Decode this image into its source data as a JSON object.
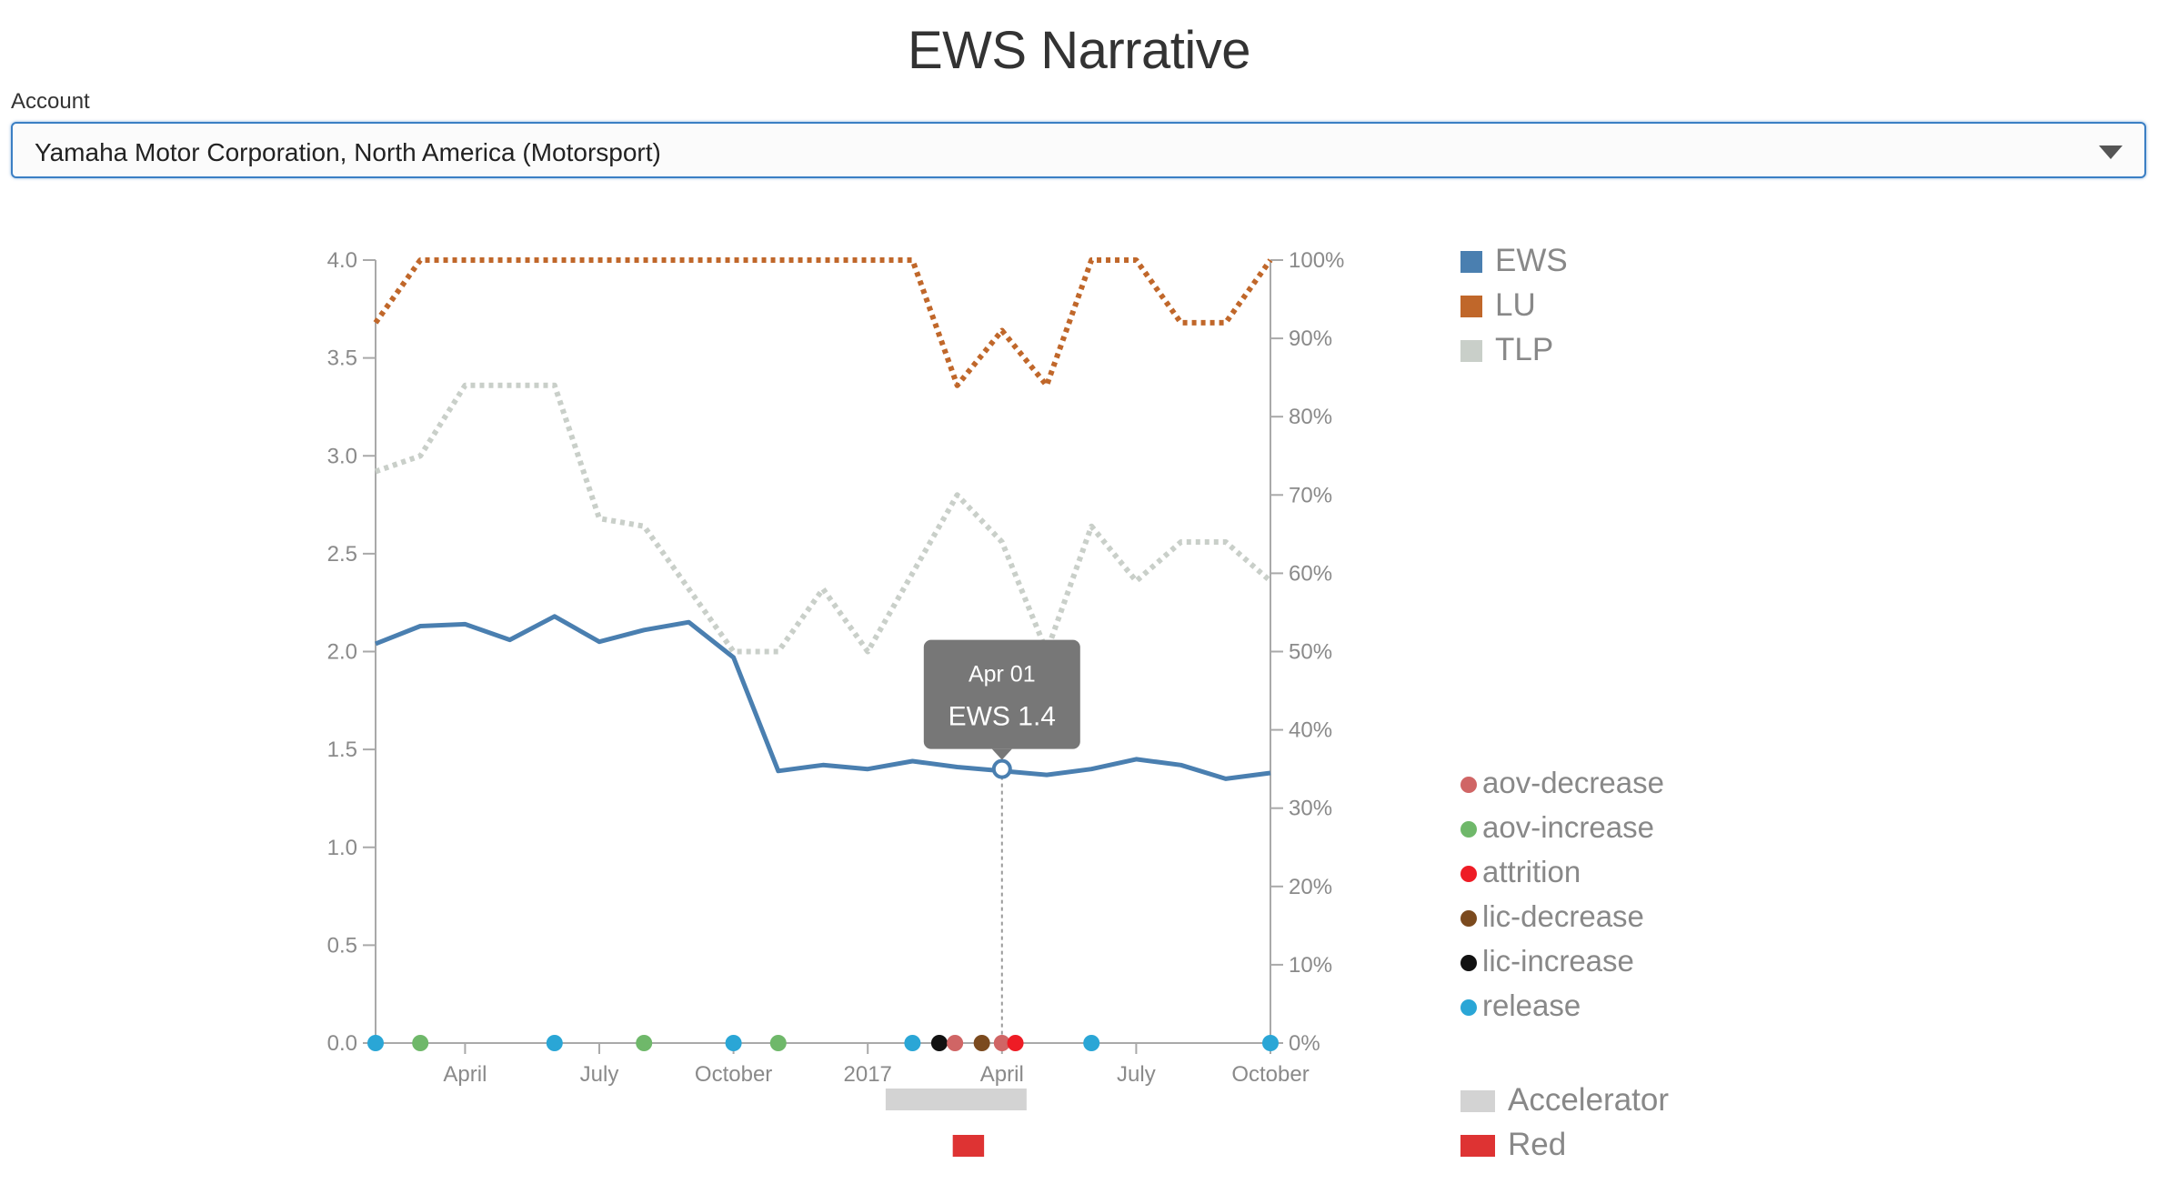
{
  "page": {
    "title": "EWS Narrative",
    "account_label": "Account",
    "account_value": "Yamaha Motor Corporation, North America (Motorsport)"
  },
  "chart_data": {
    "type": "line",
    "x_tick_labels": [
      "April",
      "July",
      "October",
      "2017",
      "April",
      "July",
      "October"
    ],
    "x_tick_months": [
      3,
      6,
      9,
      12,
      15,
      18,
      21
    ],
    "xlim_months": [
      1,
      21
    ],
    "x_points_months": [
      1,
      2,
      3,
      4,
      5,
      6,
      7,
      8,
      9,
      10,
      11,
      12,
      13,
      14,
      15,
      16,
      17,
      18,
      19,
      20,
      21
    ],
    "y_left": {
      "lim": [
        0,
        4
      ],
      "ticks": [
        "0.0",
        "0.5",
        "1.0",
        "1.5",
        "2.0",
        "2.5",
        "3.0",
        "3.5",
        "4.0"
      ]
    },
    "y_right": {
      "lim": [
        0,
        100
      ],
      "ticks": [
        "0%",
        "10%",
        "20%",
        "30%",
        "40%",
        "50%",
        "60%",
        "70%",
        "80%",
        "90%",
        "100%"
      ]
    },
    "series": [
      {
        "name": "EWS",
        "axis": "left",
        "color": "#4a7fb0",
        "style": "solid",
        "values": [
          2.04,
          2.13,
          2.14,
          2.06,
          2.18,
          2.05,
          2.11,
          2.15,
          1.97,
          1.39,
          1.42,
          1.4,
          1.44,
          1.41,
          1.39,
          1.37,
          1.4,
          1.45,
          1.42,
          1.35,
          1.38
        ]
      },
      {
        "name": "LU",
        "axis": "right",
        "color": "#c0672a",
        "style": "dotted",
        "values": [
          92,
          100,
          100,
          100,
          100,
          100,
          100,
          100,
          100,
          100,
          100,
          100,
          100,
          84,
          91,
          84,
          100,
          100,
          92,
          92,
          100
        ]
      },
      {
        "name": "TLP",
        "axis": "right",
        "color": "#c9cfc9",
        "style": "dotted",
        "values": [
          73,
          75,
          84,
          84,
          84,
          67,
          66,
          58,
          50,
          50,
          58,
          50,
          60,
          70,
          64,
          50,
          66,
          59,
          64,
          64,
          59
        ]
      }
    ],
    "events": [
      {
        "type": "release",
        "month": 1
      },
      {
        "type": "aov-increase",
        "month": 2
      },
      {
        "type": "release",
        "month": 5
      },
      {
        "type": "aov-increase",
        "month": 7
      },
      {
        "type": "release",
        "month": 9
      },
      {
        "type": "aov-increase",
        "month": 10
      },
      {
        "type": "release",
        "month": 13
      },
      {
        "type": "lic-increase",
        "month": 13.6
      },
      {
        "type": "aov-decrease",
        "month": 13.95
      },
      {
        "type": "lic-decrease",
        "month": 14.55
      },
      {
        "type": "aov-decrease",
        "month": 15
      },
      {
        "type": "attrition",
        "month": 15.3
      },
      {
        "type": "release",
        "month": 17
      },
      {
        "type": "release",
        "month": 21
      }
    ],
    "event_types": [
      {
        "name": "aov-decrease",
        "color": "#d06565"
      },
      {
        "name": "aov-increase",
        "color": "#6fb86a"
      },
      {
        "name": "attrition",
        "color": "#ee1c25"
      },
      {
        "name": "lic-decrease",
        "color": "#7b4a1e"
      },
      {
        "name": "lic-increase",
        "color": "#111111"
      },
      {
        "name": "release",
        "color": "#2aa6d6"
      }
    ],
    "zones": [
      {
        "name": "Accelerator",
        "color": "#d3d3d3",
        "start_month": 12.4,
        "end_month": 15.55
      },
      {
        "name": "Red",
        "color": "#de3333",
        "start_month": 13.9,
        "end_month": 14.6
      }
    ],
    "tooltip": {
      "date": "Apr 01",
      "text": "EWS 1.4",
      "month": 15,
      "value": 1.4
    },
    "legend_position": "right"
  }
}
